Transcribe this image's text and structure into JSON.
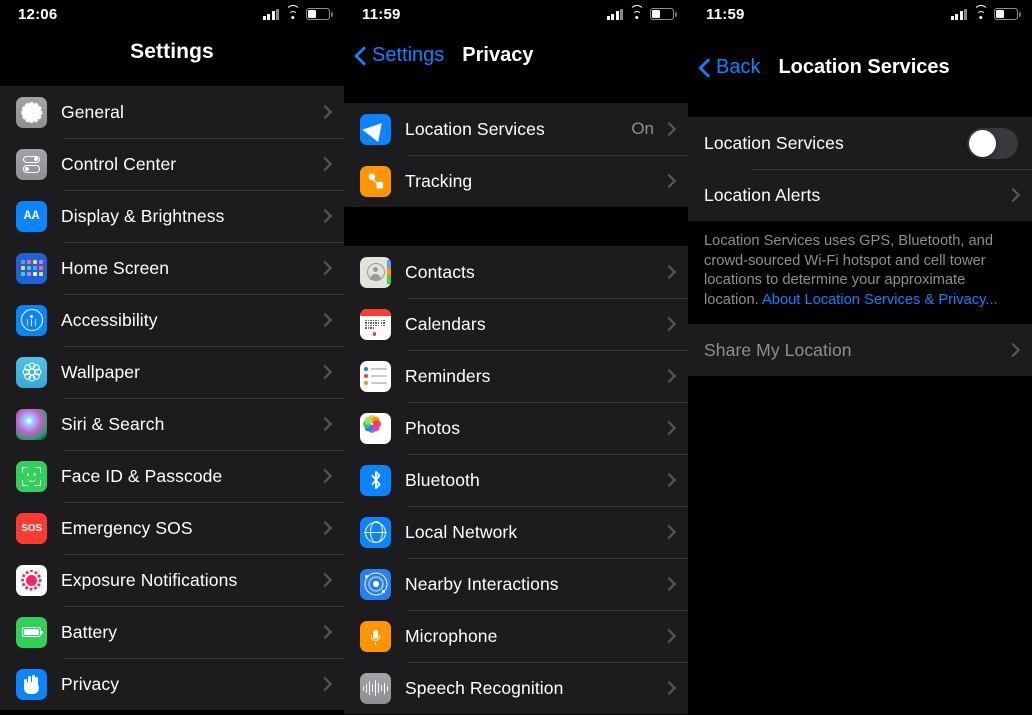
{
  "panels": [
    {
      "id": "settings",
      "statusbar": {
        "time": "12:06",
        "signal_icon": "cellular-signal-icon",
        "wifi_icon": "wifi-icon",
        "battery_icon": "battery-icon"
      },
      "nav": {
        "title": "Settings"
      },
      "sections": [
        {
          "rows": [
            {
              "label": "General",
              "icon": "gear-icon"
            },
            {
              "label": "Control Center",
              "icon": "control-center-icon"
            },
            {
              "label": "Display & Brightness",
              "icon": "display-brightness-icon",
              "icon_text": "AA"
            },
            {
              "label": "Home Screen",
              "icon": "home-screen-icon"
            },
            {
              "label": "Accessibility",
              "icon": "accessibility-icon"
            },
            {
              "label": "Wallpaper",
              "icon": "wallpaper-icon"
            },
            {
              "label": "Siri & Search",
              "icon": "siri-icon"
            },
            {
              "label": "Face ID & Passcode",
              "icon": "face-id-icon"
            },
            {
              "label": "Emergency SOS",
              "icon": "emergency-sos-icon",
              "icon_text": "SOS"
            },
            {
              "label": "Exposure Notifications",
              "icon": "exposure-notifications-icon"
            },
            {
              "label": "Battery",
              "icon": "battery-settings-icon"
            },
            {
              "label": "Privacy",
              "icon": "privacy-hand-icon"
            }
          ]
        }
      ]
    },
    {
      "id": "privacy",
      "statusbar": {
        "time": "11:59",
        "signal_icon": "cellular-signal-icon",
        "wifi_icon": "wifi-icon",
        "battery_icon": "battery-icon"
      },
      "nav": {
        "back_label": "Settings",
        "title": "Privacy",
        "back_icon": "chevron-left-icon"
      },
      "sections": [
        {
          "rows": [
            {
              "label": "Location Services",
              "value": "On",
              "icon": "location-services-icon"
            },
            {
              "label": "Tracking",
              "icon": "tracking-icon"
            }
          ]
        },
        {
          "rows": [
            {
              "label": "Contacts",
              "icon": "contacts-icon"
            },
            {
              "label": "Calendars",
              "icon": "calendars-icon"
            },
            {
              "label": "Reminders",
              "icon": "reminders-icon"
            },
            {
              "label": "Photos",
              "icon": "photos-icon"
            },
            {
              "label": "Bluetooth",
              "icon": "bluetooth-icon"
            },
            {
              "label": "Local Network",
              "icon": "local-network-icon"
            },
            {
              "label": "Nearby Interactions",
              "icon": "nearby-interactions-icon"
            },
            {
              "label": "Microphone",
              "icon": "microphone-icon"
            },
            {
              "label": "Speech Recognition",
              "icon": "speech-recognition-icon"
            }
          ]
        }
      ]
    },
    {
      "id": "location-services",
      "statusbar": {
        "time": "11:59",
        "signal_icon": "cellular-signal-icon",
        "wifi_icon": "wifi-icon",
        "battery_icon": "battery-icon"
      },
      "nav": {
        "back_label": "Back",
        "title": "Location Services",
        "back_icon": "chevron-left-icon"
      },
      "toggle_row": {
        "label": "Location Services",
        "state": "off"
      },
      "alerts_row": {
        "label": "Location Alerts"
      },
      "footnote": {
        "text": "Location Services uses GPS, Bluetooth, and crowd-sourced Wi-Fi hotspot and cell tower locations to determine your approximate location. ",
        "link": "About Location Services & Privacy..."
      },
      "share_row": {
        "label": "Share My Location",
        "disabled": true
      }
    }
  ],
  "colors": {
    "accent_blue": "#0a84ff",
    "list_bg": "#1c1c1e",
    "page_bg": "#000000",
    "separator": "#38383a",
    "secondary_text": "#8e8e93",
    "toggle_off_track": "#39393d"
  }
}
